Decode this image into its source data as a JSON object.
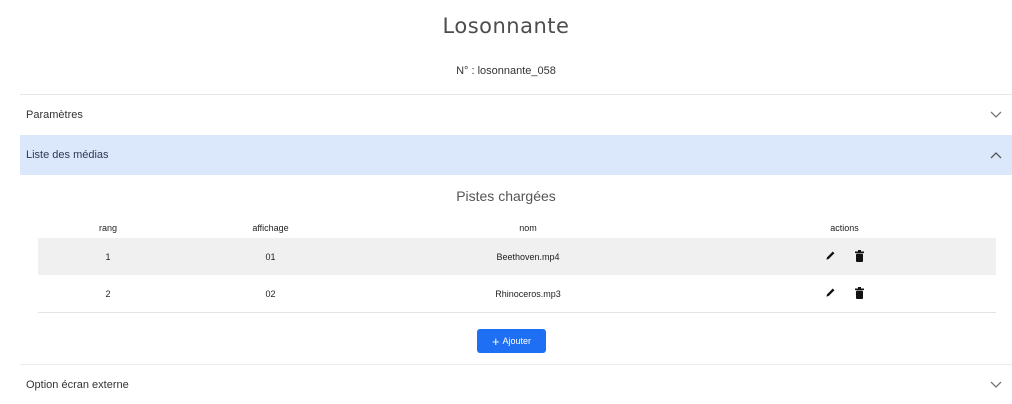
{
  "app": {
    "logo_text": "Losonnante"
  },
  "device": {
    "serial_label": "N° : losonnante_058"
  },
  "sections": {
    "parametres": "Paramètres",
    "media_list": "Liste des médias",
    "external_screen": "Option écran externe"
  },
  "media": {
    "title": "Pistes chargées",
    "columns": {
      "rang": "rang",
      "affichage": "affichage",
      "nom": "nom",
      "actions": "actions"
    },
    "rows": [
      {
        "rang": "1",
        "affichage": "01",
        "nom": "Beethoven.mp4"
      },
      {
        "rang": "2",
        "affichage": "02",
        "nom": "Rhinoceros.mp3"
      }
    ],
    "add_label": "Ajouter"
  },
  "icons": {
    "chevron_collapsed": "chevron-down-icon",
    "chevron_expanded": "chevron-up-icon",
    "edit": "pencil-icon",
    "delete": "trash-icon",
    "add": "plus-icon"
  },
  "colors": {
    "accent": "#1e6ff3",
    "expanded_header_bg": "#dbe7fb",
    "striped_row_bg": "#f0f0f0"
  }
}
